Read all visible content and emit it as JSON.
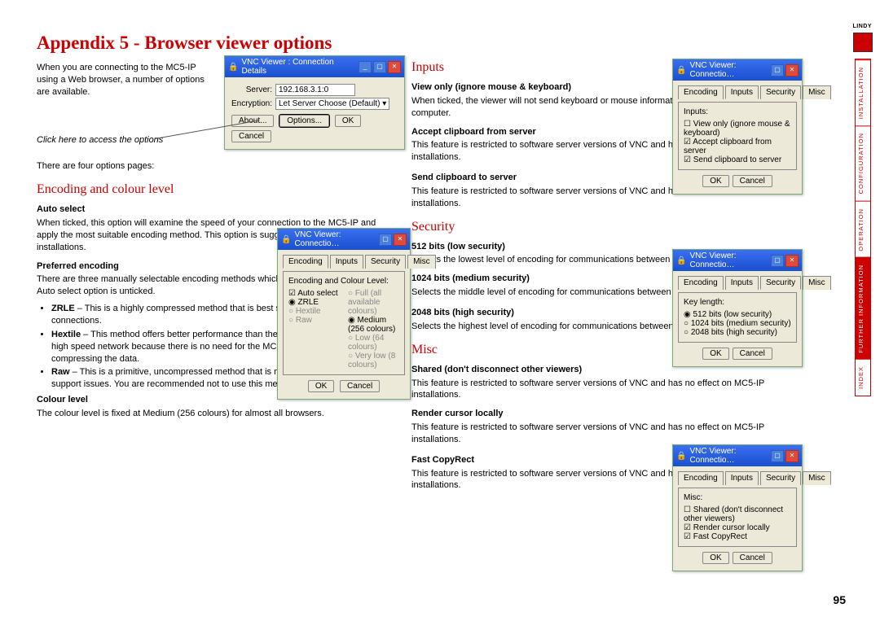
{
  "title": "Appendix 5 - Browser viewer options",
  "intro": "When you are connecting to the MC5-IP using a Web browser, a number of options are available.",
  "callout": "Click here to access the options",
  "four": "There are four options pages:",
  "page_num": "95",
  "h_encoding": "Encoding and colour level",
  "h_inputs": "Inputs",
  "h_security": "Security",
  "h_misc": "Misc",
  "auto": {
    "h": "Auto select",
    "t": "When ticked, this option will examine the speed of your connection to the MC5-IP and apply the most suitable encoding method. This option is suggested for the majority of installations."
  },
  "pref": {
    "h": "Preferred encoding",
    "t": "There are three manually selectable encoding methods which are accessible when the Auto select option is unticked."
  },
  "zrle": {
    "h": "ZRLE",
    "t": " – This is a highly compressed method that is best suited to slow modem connections."
  },
  "hextile": {
    "h": "Hextile",
    "t": " – This method offers better performance than the ZRLE when used over a high speed network because there is no need for the MC5 to spend time highly compressing the data."
  },
  "raw": {
    "h": "Raw",
    "t": " – This is a primitive, uncompressed method that is mainly used for technical support issues. You are recommended not to use this method."
  },
  "colour": {
    "h": "Colour level",
    "t": "The colour level is fixed at Medium (256 colours) for almost all browsers."
  },
  "view": {
    "h": "View only (ignore mouse & keyboard)",
    "t": "When ticked, the viewer will not send keyboard or mouse information to the MC5-IP or host computer."
  },
  "acc": {
    "h": "Accept clipboard from server",
    "t": "This feature is restricted to software server versions of VNC and has no effect on MC5-IP installations."
  },
  "send": {
    "h": "Send clipboard to server",
    "t": "This feature is restricted to software server versions of VNC and has no effect on MC5-IP installations."
  },
  "s512": {
    "h": "512 bits (low security)",
    "t": "Selects the lowest level of encoding for communications between the browser and the MC5-IP."
  },
  "s1024": {
    "h": "1024 bits (medium security)",
    "t": "Selects the middle level of encoding for communications between the browser and the MC5-IP."
  },
  "s2048": {
    "h": "2048 bits (high security)",
    "t": "Selects the highest level of encoding for communications between the browser and the MC5-IP."
  },
  "shared": {
    "h": "Shared (don't disconnect other viewers)",
    "t": "This feature is restricted to software server versions of VNC and has no effect on MC5-IP installations."
  },
  "render": {
    "h": "Render cursor locally",
    "t": "This feature is restricted to software server versions of VNC and has no effect on MC5-IP installations."
  },
  "fast": {
    "h": "Fast CopyRect",
    "t": "This feature is restricted to software server versions of VNC and has no effect on MC5-IP installations."
  },
  "nav": [
    "INSTALLATION",
    "CONFIGURATION",
    "OPERATION",
    "FURTHER INFORMATION",
    "INDEX"
  ],
  "win1": {
    "title": "VNC Viewer : Connection Details",
    "server_lbl": "Server:",
    "server": "192.168.3.1:0",
    "enc_lbl": "Encryption:",
    "enc": "Let Server Choose (Default)",
    "about": "About...",
    "options": "Options...",
    "ok": "OK",
    "cancel": "Cancel"
  },
  "win2": {
    "title": "VNC Viewer: Connectio…",
    "tabs": [
      "Encoding",
      "Inputs",
      "Security",
      "Misc"
    ],
    "sec": "Encoding and Colour Level:",
    "auto": "Auto select",
    "full": "Full (all available colours)",
    "zrle": "ZRLE",
    "med": "Medium (256 colours)",
    "hex": "Hextile",
    "low": "Low (64 colours)",
    "raw": "Raw",
    "vlow": "Very low (8 colours)",
    "ok": "OK",
    "cancel": "Cancel"
  },
  "win_in": {
    "title": "VNC Viewer: Connectio…",
    "sec": "Inputs:",
    "o1": "View only (ignore mouse & keyboard)",
    "o2": "Accept clipboard from server",
    "o3": "Send clipboard to server",
    "ok": "OK",
    "cancel": "Cancel"
  },
  "win_sec": {
    "title": "VNC Viewer: Connectio…",
    "sec": "Key length:",
    "o1": "512 bits (low security)",
    "o2": "1024 bits (medium security)",
    "o3": "2048 bits (high security)",
    "ok": "OK",
    "cancel": "Cancel"
  },
  "win_misc": {
    "title": "VNC Viewer: Connectio…",
    "sec": "Misc:",
    "o1": "Shared (don't disconnect other viewers)",
    "o2": "Render cursor locally",
    "o3": "Fast CopyRect",
    "ok": "OK",
    "cancel": "Cancel"
  }
}
